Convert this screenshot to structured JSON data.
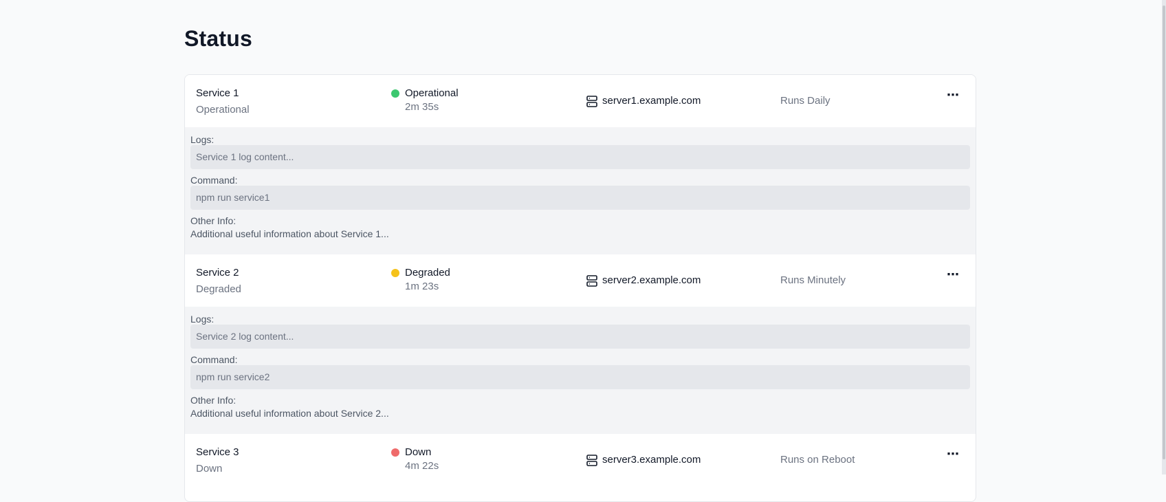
{
  "page": {
    "title": "Status"
  },
  "colors": {
    "operational": "#3cc76f",
    "degraded": "#f5c21a",
    "down": "#ef6b6b"
  },
  "details_labels": {
    "logs": "Logs:",
    "command": "Command:",
    "other_info": "Other Info:"
  },
  "services": [
    {
      "name": "Service 1",
      "status_text": "Operational",
      "status_label": "Operational",
      "status_color": "operational",
      "duration": "2m 35s",
      "server": "server1.example.com",
      "schedule": "Runs Daily",
      "more_icon": "more-horizontal-icon",
      "logs": "Service 1 log content...",
      "command": "npm run service1",
      "other_info": "Additional useful information about Service 1..."
    },
    {
      "name": "Service 2",
      "status_text": "Degraded",
      "status_label": "Degraded",
      "status_color": "degraded",
      "duration": "1m 23s",
      "server": "server2.example.com",
      "schedule": "Runs Minutely",
      "more_icon": "more-horizontal-icon",
      "logs": "Service 2 log content...",
      "command": "npm run service2",
      "other_info": "Additional useful information about Service 2..."
    },
    {
      "name": "Service 3",
      "status_text": "Down",
      "status_label": "Down",
      "status_color": "down",
      "duration": "4m 22s",
      "server": "server3.example.com",
      "schedule": "Runs on Reboot",
      "more_icon": "more-horizontal-icon"
    }
  ]
}
